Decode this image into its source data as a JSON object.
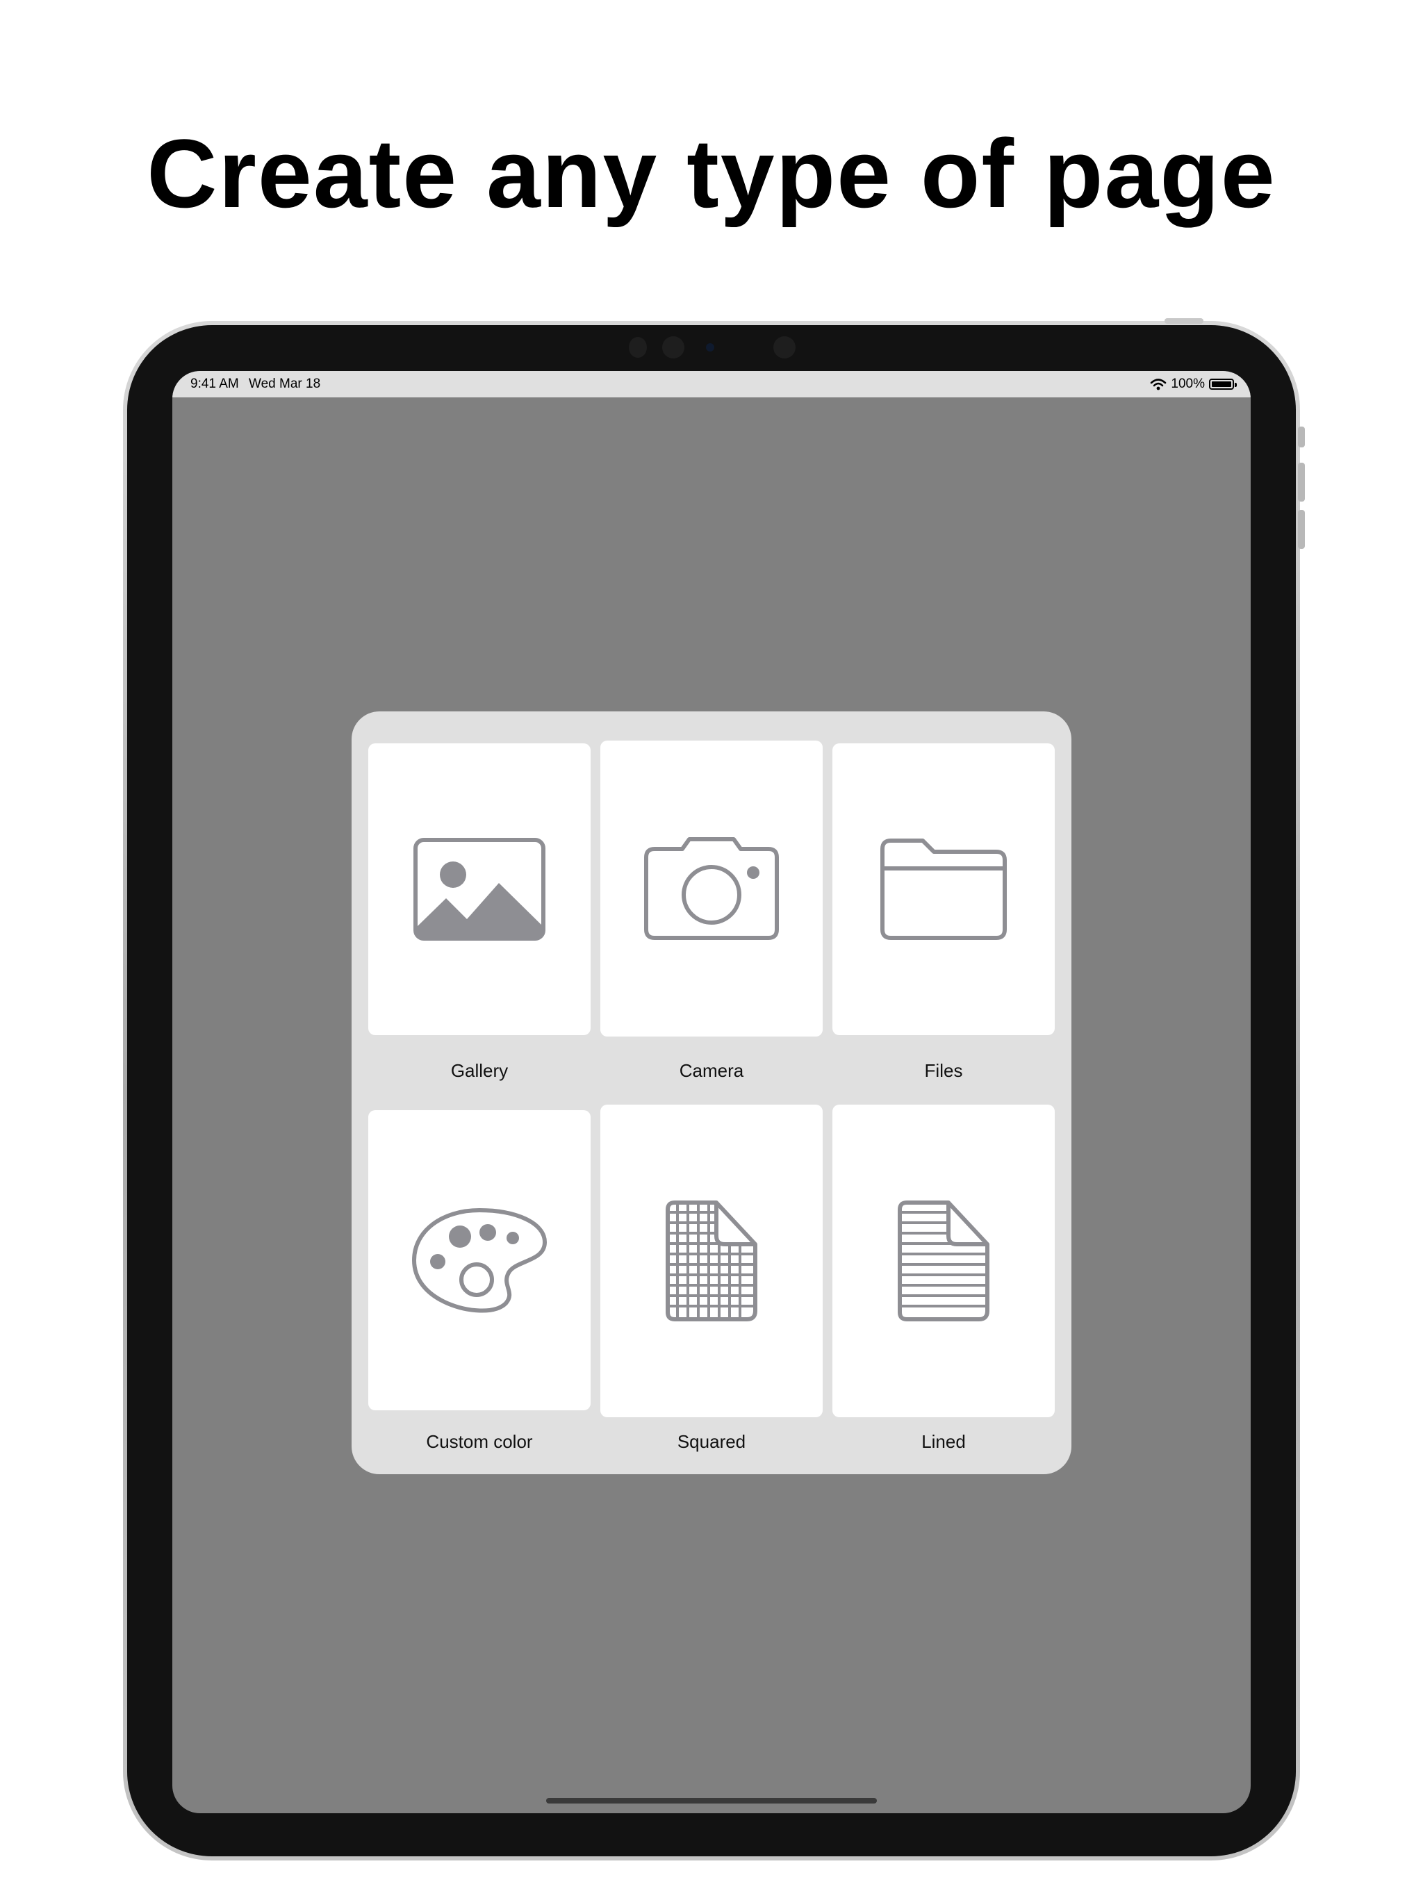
{
  "headline": "Create any type of page",
  "status_bar": {
    "time": "9:41 AM",
    "date": "Wed Mar 18",
    "battery": "100%",
    "icons": [
      "wifi-icon",
      "battery-icon"
    ]
  },
  "options": [
    {
      "label": "Gallery",
      "icon": "photo-icon"
    },
    {
      "label": "Camera",
      "icon": "camera-icon"
    },
    {
      "label": "Files",
      "icon": "folder-icon"
    },
    {
      "label": "Custom color",
      "icon": "palette-icon"
    },
    {
      "label": "Squared",
      "icon": "grid-paper-icon"
    },
    {
      "label": "Lined",
      "icon": "lined-paper-icon"
    }
  ],
  "colors": {
    "screen_dim": "#808080",
    "panel": "#e0e0e0",
    "card": "#ffffff",
    "icon": "#8e8e93"
  }
}
